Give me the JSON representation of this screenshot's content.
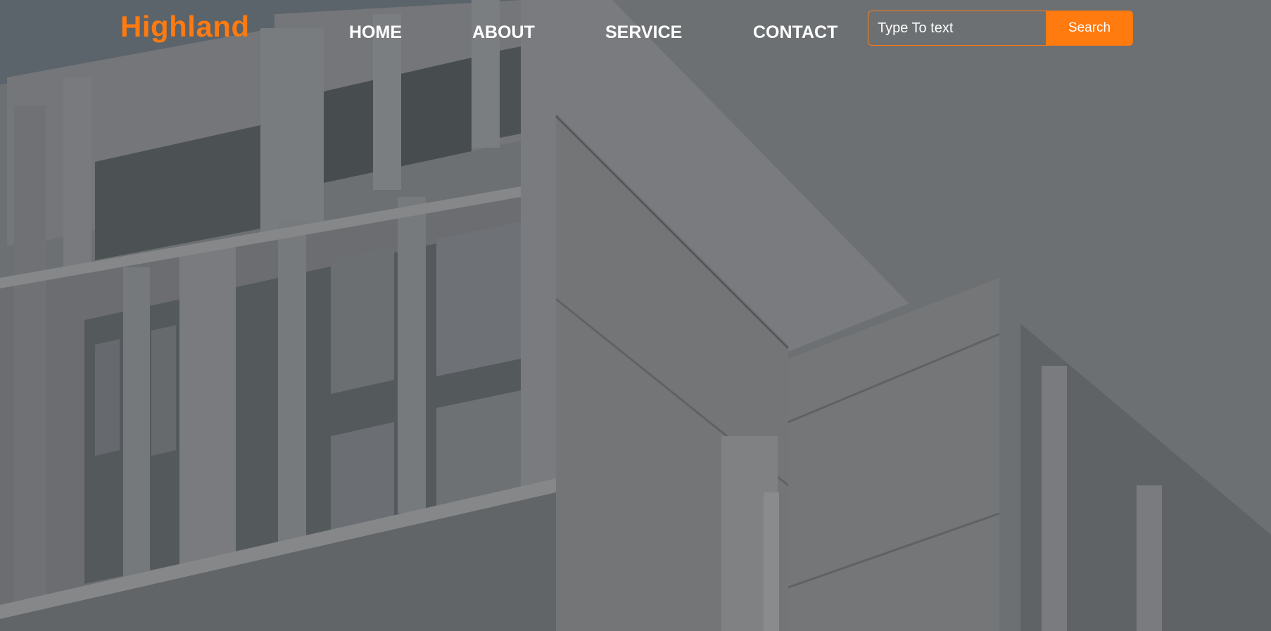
{
  "brand": {
    "name": "Highland"
  },
  "nav": {
    "items": [
      {
        "id": "home",
        "label": "HOME"
      },
      {
        "id": "about",
        "label": "ABOUT"
      },
      {
        "id": "service",
        "label": "SERVICE"
      },
      {
        "id": "contact",
        "label": "CONTACT"
      }
    ]
  },
  "search": {
    "placeholder": "Type To text",
    "value": "",
    "button_label": "Search"
  },
  "colors": {
    "accent": "#ff7a0f",
    "nav_text": "#ffffff",
    "sky": "#6a7278",
    "building_light": "#8a8c8f",
    "building_shadow": "#707375"
  },
  "icons": {
    "hero_image": "building-photo"
  }
}
